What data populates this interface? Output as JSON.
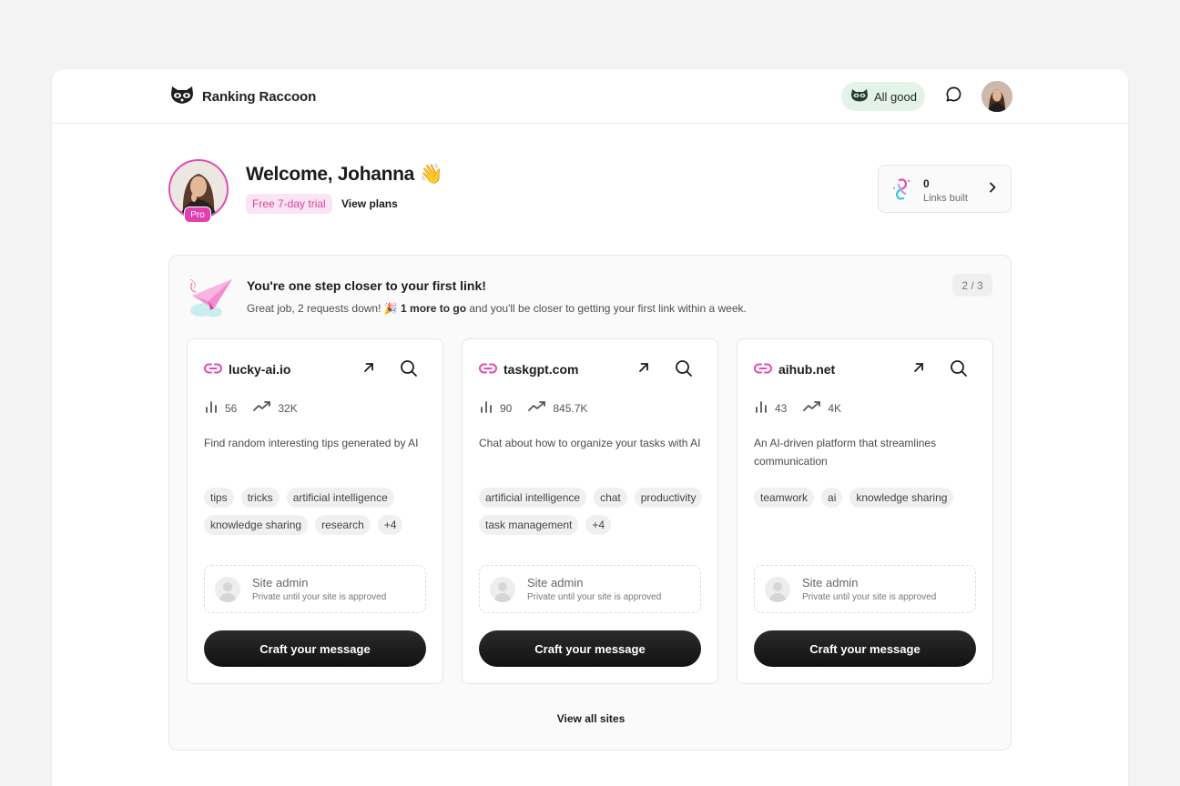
{
  "header": {
    "logo_text": "Ranking Raccoon",
    "status": "All good"
  },
  "welcome": {
    "title": "Welcome, Johanna 👋",
    "badge": "Pro",
    "trial": "Free 7-day trial",
    "view_plans": "View plans"
  },
  "links": {
    "count": "0",
    "label": "Links built"
  },
  "progress": {
    "title": "You're one step closer to your first link!",
    "sub_prefix": "Great job, 2 requests down! 🎉 ",
    "sub_bold": "1 more to go",
    "sub_suffix": " and you'll be closer to getting your first link within a week.",
    "step": "2 / 3"
  },
  "cards": [
    {
      "domain": "lucky-ai.io",
      "stat1": "56",
      "stat2": "32K",
      "description": "Find random interesting tips generated by AI",
      "tags": [
        "tips",
        "tricks",
        "artificial intelligence",
        "knowledge sharing",
        "research",
        "+4"
      ],
      "admin_name": "Site admin",
      "admin_note": "Private until your site is approved",
      "cta": "Craft your message"
    },
    {
      "domain": "taskgpt.com",
      "stat1": "90",
      "stat2": "845.7K",
      "description": "Chat about how to organize your tasks with AI",
      "tags": [
        "artificial intelligence",
        "chat",
        "productivity",
        "task management",
        "+4"
      ],
      "admin_name": "Site admin",
      "admin_note": "Private until your site is approved",
      "cta": "Craft your message"
    },
    {
      "domain": "aihub.net",
      "stat1": "43",
      "stat2": "4K",
      "description": "An AI-driven platform that streamlines communication",
      "tags": [
        "teamwork",
        "ai",
        "knowledge sharing"
      ],
      "admin_name": "Site admin",
      "admin_note": "Private until your site is approved",
      "cta": "Craft your message"
    }
  ],
  "view_all": "View all sites",
  "colors": {
    "accent": "#e14bb3",
    "status_bg": "#e3f3e8",
    "cta_bg": "#1a1a1a"
  }
}
